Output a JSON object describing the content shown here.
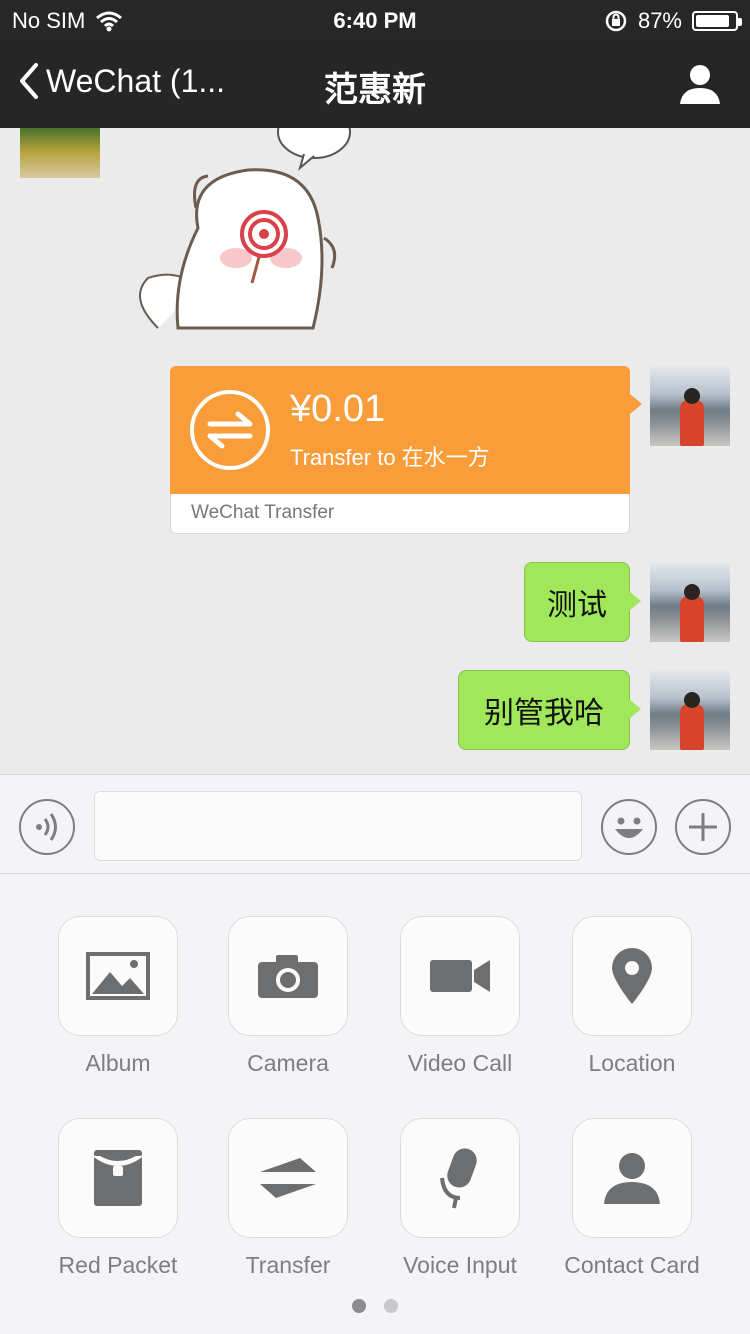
{
  "status_bar": {
    "carrier": "No SIM",
    "time": "6:40 PM",
    "battery": "87%",
    "battery_level": 0.87,
    "icons": [
      "wifi-icon",
      "rotation-lock-icon",
      "battery-icon"
    ]
  },
  "nav": {
    "back_label": "WeChat (1...",
    "title": "范惠新",
    "icons": [
      "chevron-left-icon",
      "profile-icon"
    ]
  },
  "messages": {
    "transfer": {
      "amount": "¥0.01",
      "description": "Transfer to 在水一方",
      "footer": "WeChat Transfer"
    },
    "text_1": "测试",
    "text_2": "别管我哈"
  },
  "input": {
    "value": "",
    "placeholder": "",
    "icons": [
      "voice-icon",
      "emoji-icon",
      "plus-icon"
    ]
  },
  "panel": {
    "tools": [
      {
        "label": "Album",
        "icon": "album-icon"
      },
      {
        "label": "Camera",
        "icon": "camera-icon"
      },
      {
        "label": "Video Call",
        "icon": "video-call-icon"
      },
      {
        "label": "Location",
        "icon": "location-icon"
      },
      {
        "label": "Red Packet",
        "icon": "red-packet-icon"
      },
      {
        "label": "Transfer",
        "icon": "transfer-icon"
      },
      {
        "label": "Voice Input",
        "icon": "microphone-icon"
      },
      {
        "label": "Contact Card",
        "icon": "contact-card-icon"
      }
    ],
    "page_count": 2,
    "current_page": 1
  },
  "colors": {
    "header": "#262626",
    "chat_bg": "#ebebeb",
    "transfer_orange": "#f89d3a",
    "bubble_green": "#a0e75a",
    "icon_gray": "#6d6e70"
  }
}
